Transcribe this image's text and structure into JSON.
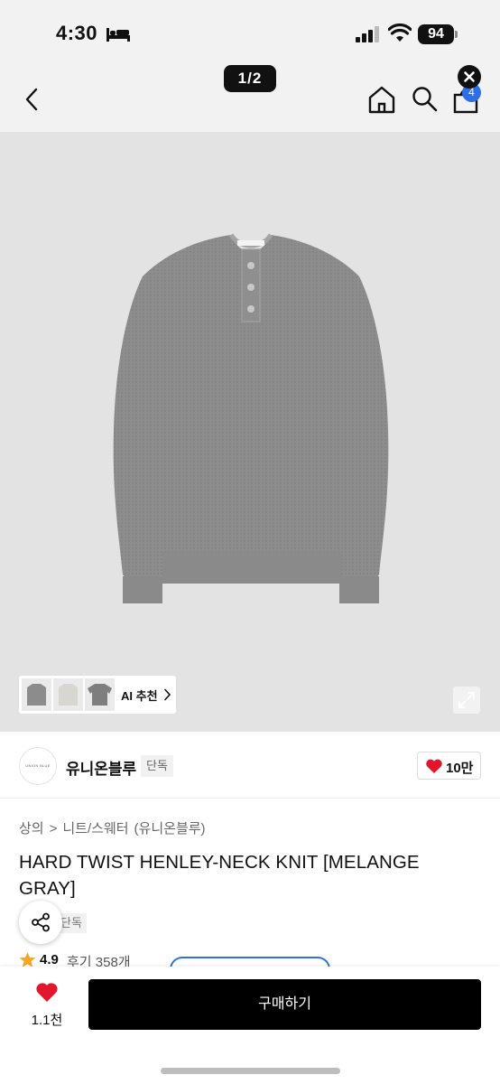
{
  "status_bar": {
    "time": "4:30",
    "battery": "94",
    "icons": [
      "bed-icon",
      "signal-icon",
      "wifi-icon",
      "battery-icon"
    ]
  },
  "nav": {
    "page_counter": "1/2",
    "cart_count": "4",
    "icons": [
      "chevron-left-icon",
      "home-icon",
      "search-icon",
      "shopping-bag-icon",
      "close-icon"
    ]
  },
  "hero": {
    "ai_label": "AI 추천",
    "expand_icon": "expand-icon"
  },
  "brand": {
    "logo_text": "UNION BLUE",
    "name": "유니온블루",
    "exclusive": "단독",
    "likes": "10만"
  },
  "product": {
    "breadcrumb": [
      "상의",
      ">",
      "니트/스웨터",
      "(유니온블루)"
    ],
    "title": "HARD TWIST HENLEY-NECK KNIT [MELANGE GRAY]",
    "badge_behind": "단독",
    "rating": "4.9",
    "reviews": "후기 358개"
  },
  "bottom_bar": {
    "wish_count": "1.1천",
    "buy_label": "구매하기"
  },
  "colors": {
    "accent_blue": "#2f6fe6",
    "heart_red": "#e2162c",
    "star_orange": "#f5a623",
    "buy_button": "#000000"
  }
}
